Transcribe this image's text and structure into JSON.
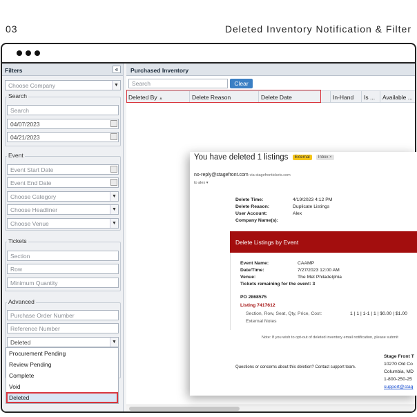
{
  "slide": {
    "number": "03",
    "title": "Deleted Inventory Notification & Filter"
  },
  "filters": {
    "title": "Filters",
    "collapse_icon": "«",
    "company_placeholder": "Choose Company",
    "search": {
      "label": "Search",
      "search_placeholder": "Search",
      "date_from": "04/07/2023",
      "date_to": "04/21/2023"
    },
    "event": {
      "label": "Event",
      "start_placeholder": "Event Start Date",
      "end_placeholder": "Event End Date",
      "category_placeholder": "Choose Category",
      "headliner_placeholder": "Choose Headliner",
      "venue_placeholder": "Choose Venue"
    },
    "tickets": {
      "label": "Tickets",
      "section_placeholder": "Section",
      "row_placeholder": "Row",
      "min_qty_placeholder": "Minimum Quantity"
    },
    "advanced": {
      "label": "Advanced",
      "po_placeholder": "Purchase Order Number",
      "ref_placeholder": "Reference Number",
      "status_value": "Deleted",
      "status_options": [
        "Procurement Pending",
        "Review Pending",
        "Complete",
        "Void",
        "Deleted"
      ]
    }
  },
  "main": {
    "title": "Purchased Inventory",
    "search_placeholder": "Search",
    "clear_label": "Clear",
    "columns": [
      "Deleted By",
      "Delete Reason",
      "Delete Date",
      "In-Hand",
      "Is ...",
      "Available ..."
    ]
  },
  "email": {
    "subject": "You have deleted 1 listings",
    "tag_external": "External",
    "tag_inbox": "Inbox ×",
    "from": "no-reply@stagefront.com",
    "via": "via stagefrontickets.com",
    "to": "to alex ▾",
    "details": [
      {
        "k": "Delete Time:",
        "v": "4/19/2023 4:12 PM"
      },
      {
        "k": "Delete Reason:",
        "v": "Duplicate Listings"
      },
      {
        "k": "User Account:",
        "v": "Alex"
      },
      {
        "k": "Company Name(s):",
        "v": ""
      }
    ],
    "band_title": "Delete Listings by Event",
    "event": [
      {
        "k": "Event Name:",
        "v": "CAAMP"
      },
      {
        "k": "Date/Time:",
        "v": "7/27/2023 12:00 AM"
      },
      {
        "k": "Venue:",
        "v": "The Met Philadelphia"
      }
    ],
    "tickets_remaining": "Tickets remaining for the event: 3",
    "po": "PO 2868575",
    "listing": "Listing 7417612",
    "listing_fields": "Section, Row, Seat, Qty, Price, Cost:",
    "listing_values": "1 | 1 | 1-1 | 1 | $0.00 | $1.00",
    "external_notes": "External Notes",
    "optout_note": "Note: If you wish to opt-out of deleted inventory email notification, please submit",
    "questions": "Questions or concerns about this deletion? Contact support team.",
    "company_block": [
      "Stage Front T",
      "10270 Old Co",
      "Columbia, MD",
      "1-800-250-25",
      "support@stag"
    ]
  }
}
